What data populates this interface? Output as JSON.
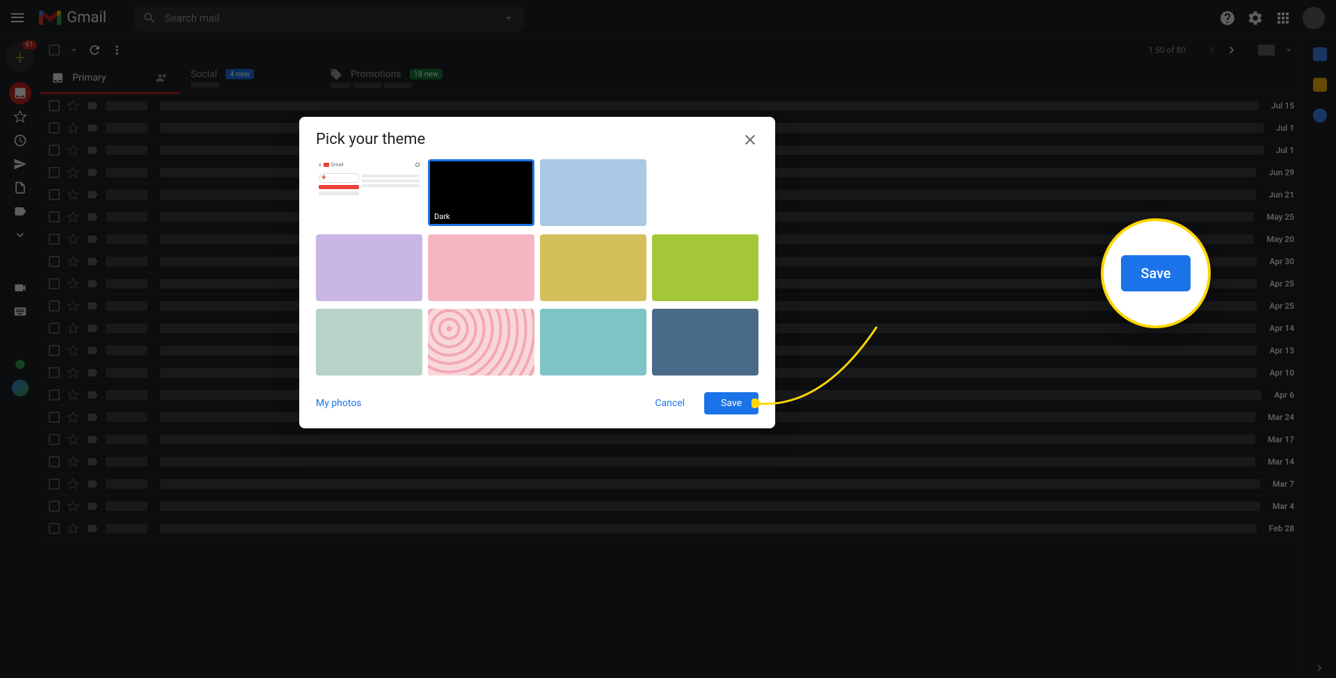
{
  "header": {
    "logo_text": "Gmail",
    "search_placeholder": "Search mail"
  },
  "compose_badge": "61",
  "toolbar": {
    "page_info": "1 50 of 80"
  },
  "tabs": {
    "primary": {
      "label": "Primary"
    },
    "social": {
      "label": "Social",
      "badge": "4 new"
    },
    "promotions": {
      "label": "Promotions",
      "badge": "18 new"
    }
  },
  "emails": [
    {
      "date": "Jul 15"
    },
    {
      "date": "Jul 1"
    },
    {
      "date": "Jul 1"
    },
    {
      "date": "Jun 29"
    },
    {
      "date": "Jun 21"
    },
    {
      "date": "May 25"
    },
    {
      "date": "May 20"
    },
    {
      "date": "Apr 30"
    },
    {
      "date": "Apr 25"
    },
    {
      "date": "Apr 25"
    },
    {
      "date": "Apr 14"
    },
    {
      "date": "Apr 13"
    },
    {
      "date": "Apr 10"
    },
    {
      "date": "Apr 6"
    },
    {
      "date": "Mar 24"
    },
    {
      "date": "Mar 17"
    },
    {
      "date": "Mar 14"
    },
    {
      "date": "Mar 7"
    },
    {
      "date": "Mar 4"
    },
    {
      "date": "Feb 28"
    }
  ],
  "modal": {
    "title": "Pick your theme",
    "my_photos": "My photos",
    "cancel": "Cancel",
    "save": "Save",
    "themes": [
      {
        "color": "#ffffff",
        "label": "",
        "preview": true
      },
      {
        "color": "#000000",
        "label": "Dark",
        "selected": true
      },
      {
        "color": "#a8c8e4",
        "label": ""
      },
      {
        "color": "#ffffff",
        "label": ""
      },
      {
        "color": "#c9b6e4",
        "label": ""
      },
      {
        "color": "#f4b6c2",
        "label": ""
      },
      {
        "color": "#d4c05a",
        "label": ""
      },
      {
        "color": "#a4c639",
        "label": ""
      },
      {
        "color": "#b8d4c8",
        "label": ""
      },
      {
        "color": "#f8d7da",
        "label": "",
        "pattern": true
      },
      {
        "color": "#7ec4c4",
        "label": ""
      },
      {
        "color": "#4a6a8a",
        "label": ""
      }
    ]
  },
  "callout": {
    "save": "Save"
  }
}
